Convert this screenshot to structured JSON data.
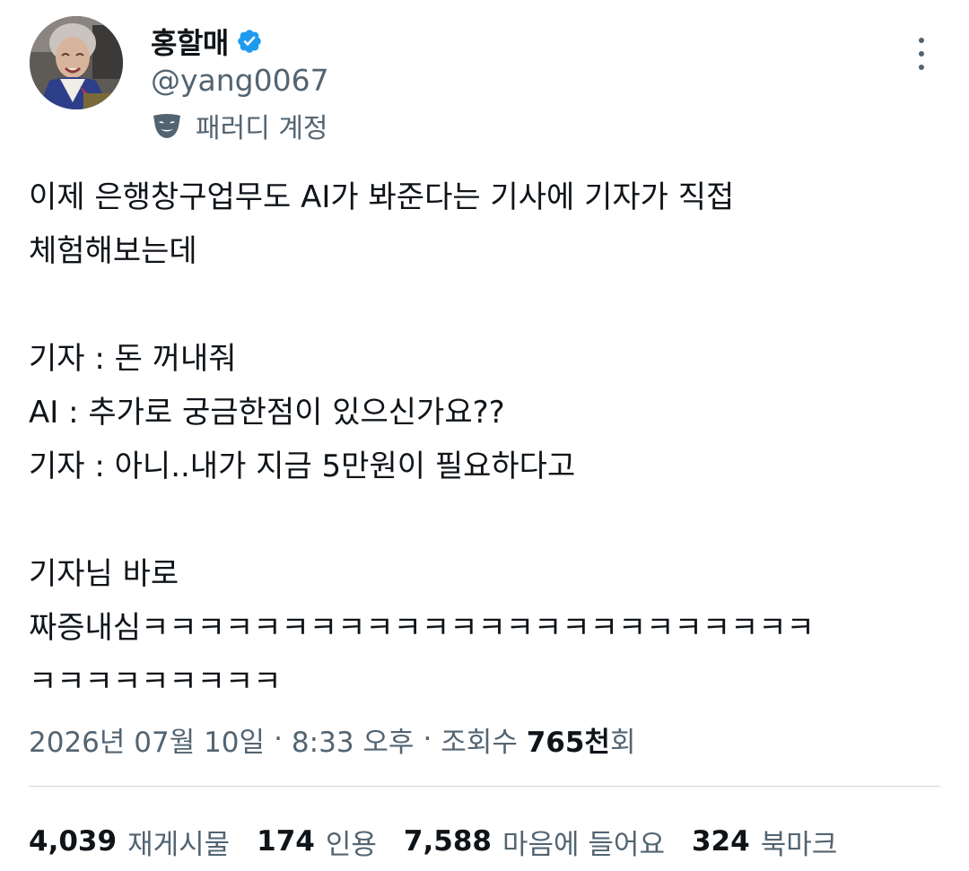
{
  "author": {
    "display_name": "홍할매",
    "handle": "@yang0067",
    "parody_label": "패러디 계정"
  },
  "tweet": {
    "lines": [
      "이제 은행창구업무도 AI가 봐준다는 기사에 기자가 직접",
      "체험해보는데",
      "",
      "기자 : 돈 꺼내줘",
      "AI : 추가로 궁금한점이 있으신가요??",
      "기자 : 아니..내가 지금 5만원이 필요하다고",
      "",
      "기자님 바로",
      "짜증내심ㅋㅋㅋㅋㅋㅋㅋㅋㅋㅋㅋㅋㅋㅋㅋㅋㅋㅋㅋㅋㅋㅋㅋㅋ",
      "ㅋㅋㅋㅋㅋㅋㅋㅋㅋ"
    ]
  },
  "meta": {
    "date": "2026년 07월 10일",
    "separator": "·",
    "time": "8:33 오후",
    "views_label": "조회수",
    "views_count": "765천",
    "views_suffix": "회"
  },
  "stats": {
    "retweets_count": "4,039",
    "retweets_label": "재게시물",
    "quotes_count": "174",
    "quotes_label": "인용",
    "likes_count": "7,588",
    "likes_label": "마음에 들어요",
    "bookmarks_count": "324",
    "bookmarks_label": "북마크"
  },
  "colors": {
    "verified": "#1d9bf0",
    "secondary_text": "#536471",
    "primary_text": "#0f1419",
    "divider": "#cfd9de"
  },
  "icons": {
    "verified": "verified-badge-icon",
    "parody": "mask-icon",
    "more": "more-vertical-icon"
  }
}
